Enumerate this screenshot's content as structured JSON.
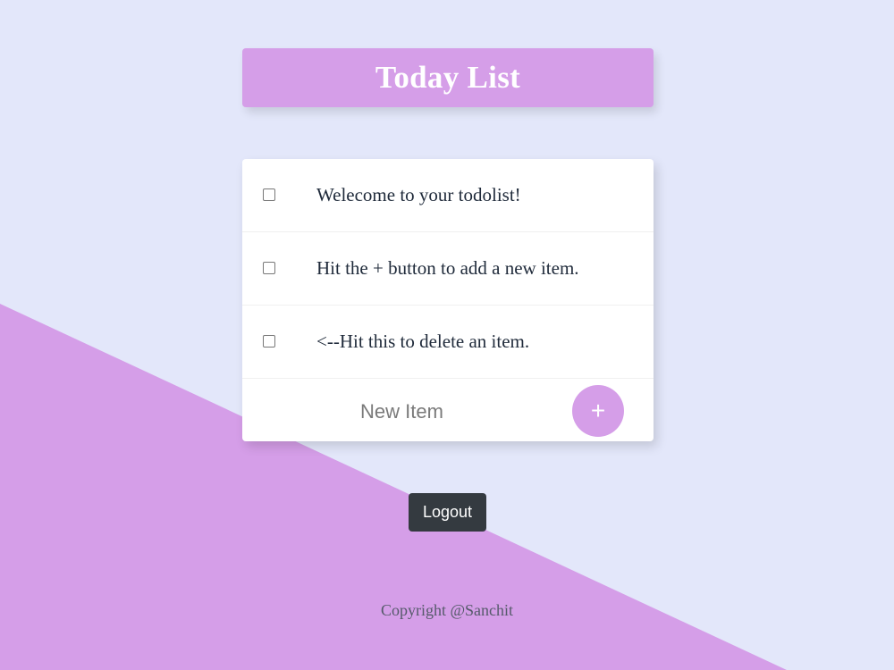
{
  "colors": {
    "page_background": "#e3e7fa",
    "accent_purple": "#d59ee8",
    "card_background": "#ffffff",
    "logout_button": "#343a40"
  },
  "header": {
    "title": "Today List"
  },
  "todo": {
    "items": [
      {
        "text": "Welecome to your todolist!",
        "checked": false
      },
      {
        "text": "Hit the + button to add a new item.",
        "checked": false
      },
      {
        "text": "<--Hit this to delete an item.",
        "checked": false
      }
    ],
    "new_item": {
      "placeholder": "New Item",
      "value": ""
    },
    "add_button_label": "+"
  },
  "logout_label": "Logout",
  "footer": {
    "copyright": "Copyright @Sanchit"
  }
}
